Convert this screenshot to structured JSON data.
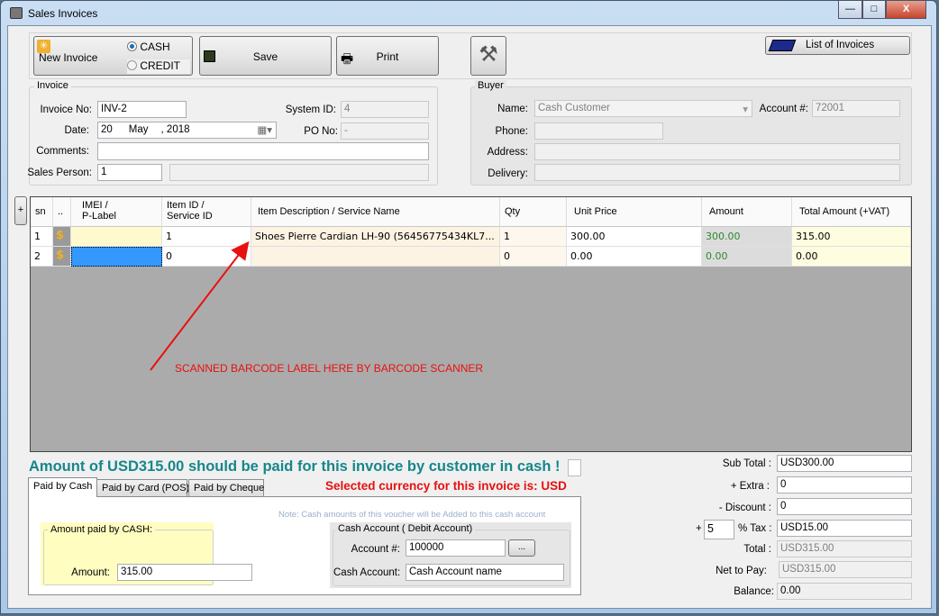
{
  "window": {
    "title": "Sales Invoices",
    "minimize": "—",
    "maximize": "□",
    "close": "X"
  },
  "toolbar": {
    "new_invoice": "New Invoice",
    "cash": "CASH",
    "credit": "CREDIT",
    "payment_mode_selected": "CASH",
    "save": "Save",
    "print": "Print",
    "list_of_invoices": "List of Invoices"
  },
  "invoice": {
    "group": "Invoice",
    "invoice_no_label": "Invoice No:",
    "invoice_no": "INV-2",
    "date_label": "Date:",
    "date_day": "20",
    "date_month": "May",
    "date_year": ", 2018",
    "comments_label": "Comments:",
    "comments": "",
    "sales_person_label": "Sales Person:",
    "sales_person": "1",
    "sales_person_name": "",
    "system_id_label": "System ID:",
    "system_id": "4",
    "po_no_label": "PO No:",
    "po_no": "-"
  },
  "buyer": {
    "group": "Buyer",
    "name_label": "Name:",
    "name": "Cash Customer",
    "account_label": "Account #:",
    "account": "72001",
    "phone_label": "Phone:",
    "phone": "",
    "address_label": "Address:",
    "address": "",
    "delivery_label": "Delivery:",
    "delivery": ""
  },
  "grid": {
    "add_button": "+",
    "columns": [
      "sn",
      "..",
      "IMEI /\nP-Label",
      "Item ID /\nService ID",
      "Item Description  / Service Name",
      "Qty",
      "Unit Price",
      "Amount",
      "Total Amount (+VAT)"
    ],
    "rows": [
      {
        "sn": "1",
        "imei": "",
        "item_id": "1",
        "description": "Shoes Pierre Cardian LH-90 (56456775434KL7...",
        "qty": "1",
        "unit_price": "300.00",
        "amount": "300.00",
        "total": "315.00"
      },
      {
        "sn": "2",
        "imei": "",
        "item_id": "0",
        "description": "",
        "qty": "0",
        "unit_price": "0.00",
        "amount": "0.00",
        "total": "0.00"
      }
    ],
    "annotation": "SCANNED BARCODE LABEL HERE BY BARCODE SCANNER"
  },
  "payment": {
    "message": "Amount of USD315.00 should be paid for this invoice by customer in cash !",
    "currency_message": "Selected currency for this invoice is: USD",
    "tabs": [
      "Paid by Cash",
      "Paid by Card (POS)",
      "Paid by Cheque"
    ],
    "active_tab": "Paid by Cash",
    "note": "Note: Cash amounts of this voucher will be Added to  this cash account",
    "cash_group": "Amount paid by CASH:",
    "amount_label": "Amount:",
    "amount": "315.00",
    "account_group": "Cash Account ( Debit Account)",
    "account_no_label": "Account #:",
    "account_no": "100000",
    "browse": "...",
    "cash_account_label": "Cash Account:",
    "cash_account": "Cash Account name"
  },
  "totals": {
    "sub_total_label": "Sub Total :",
    "sub_total": "USD300.00",
    "extra_label": "+ Extra :",
    "extra": "0",
    "discount_label": "- Discount :",
    "discount": "0",
    "tax_plus": "+",
    "tax_rate": "5",
    "tax_label": "% Tax :",
    "tax": "USD15.00",
    "total_label": "Total :",
    "total": "USD315.00",
    "net_label": "Net to Pay:",
    "net": "USD315.00",
    "balance_label": "Balance:",
    "balance": "0.00"
  },
  "colors": {
    "message": "#17868a",
    "currency": "#e81010",
    "annotation": "#e81010",
    "amount_green": "#2d8a2d",
    "selected_cell": "#3399ff"
  }
}
